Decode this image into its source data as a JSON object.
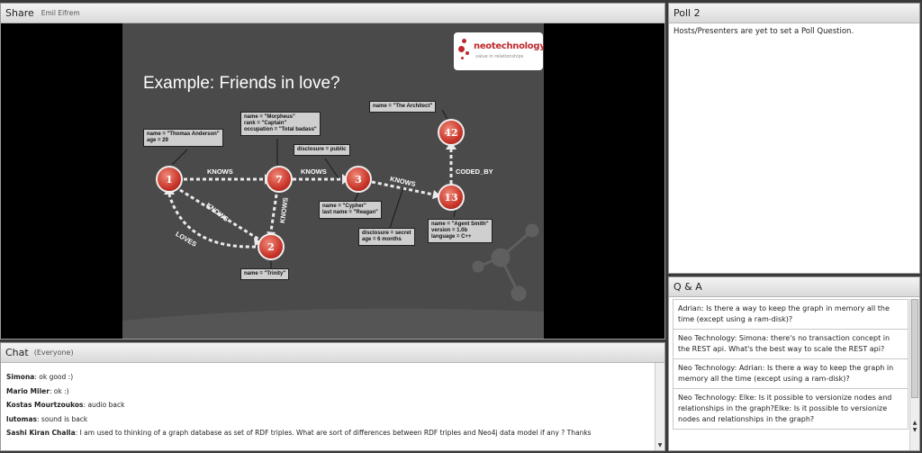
{
  "share": {
    "title": "Share",
    "presenter": "Emil Eifrem",
    "slide": {
      "title": "Example: Friends in love?",
      "logo": {
        "name": "neotechnology",
        "tagline": "value in relationships"
      },
      "nodes": [
        "1",
        "7",
        "3",
        "13",
        "42",
        "2"
      ],
      "props": {
        "n1": "name = \"Thomas Anderson\"\nage = 29",
        "n7": "name = \"Morpheus\"\nrank = \"Captain\"\noccupation = \"Total badass\"",
        "n3": "name = \"Cypher\"\nlast name = \"Reagan\"",
        "n13": "name = \"Agent Smith\"\nversion = 1.0b\nlanguage = C++",
        "n42": "name = \"The Architect\"",
        "n2": "name = \"Trinity\"",
        "rel_public": "disclosure = public",
        "rel_secret": "disclosure = secret\nage = 6 months"
      },
      "relationships": {
        "knows_1_7": "KNOWS",
        "knows_7_3": "KNOWS",
        "knows_3_13": "KNOWS",
        "knows_1_2": "KNOWS",
        "knows_7_2": "KNOWS",
        "loves": "LOVES",
        "coded_by": "CODED_BY"
      }
    }
  },
  "poll": {
    "title": "Poll 2",
    "message": "Hosts/Presenters are yet to set a Poll Question."
  },
  "qa": {
    "title": "Q & A",
    "items": [
      "Adrian: Is there a way to keep the graph in memory all the time (except using a ram-disk)?",
      "Neo Technology: Simona: there's no transaction concept in the REST api. What's the best way to scale the REST api?",
      "Neo Technology: Adrian: Is there a way to keep the graph in memory all the time (except using a ram-disk)?",
      "Neo Technology: Elke: Is it possible to versionize nodes and relationships in the graph?Elke: Is it possible to versionize nodes and relationships in the graph?"
    ]
  },
  "chat": {
    "title": "Chat",
    "audience": "(Everyone)",
    "messages": [
      {
        "author": "Simona",
        "text": "ok good :)"
      },
      {
        "author": "Mario Miler",
        "text": "ok :)"
      },
      {
        "author": "Kostas Mourtzoukos",
        "text": "audio back"
      },
      {
        "author": "lutomas",
        "text": "sound is back"
      },
      {
        "author": "Sashi Kiran Challa",
        "text": "I am used to thinking of a graph database as set of RDF triples. What are sort of differences between RDF triples and Neo4j data model if any ? Thanks"
      }
    ]
  }
}
